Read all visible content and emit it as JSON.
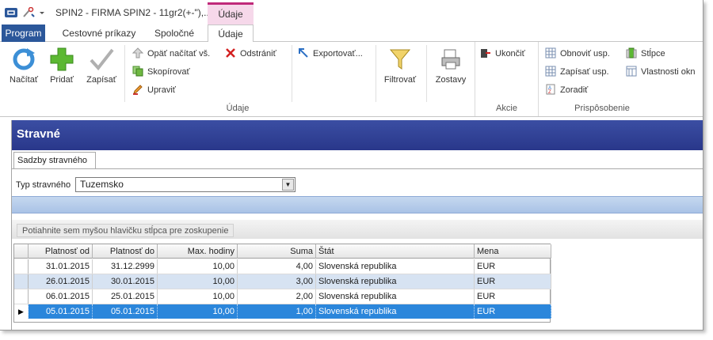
{
  "titlebar": {
    "title": "SPIN2 - FIRMA SPIN2 - 11gr2(+-\"),..",
    "context_tab": "Údaje"
  },
  "tabs": [
    {
      "label": "Program"
    },
    {
      "label": "Cestovné príkazy"
    },
    {
      "label": "Spoločné"
    },
    {
      "label": "Údaje"
    }
  ],
  "ribbon": {
    "buttons": {
      "nacitat": "Načítať",
      "pridat": "Pridať",
      "zapisat": "Zapísať",
      "opat": "Opäť načítať vš.",
      "skopirovat": "Skopírovať",
      "upravit": "Upraviť",
      "odstranit": "Odstrániť",
      "exportovat": "Exportovať...",
      "filtrovat": "Filtrovať",
      "zostavy": "Zostavy",
      "ukoncit": "Ukončiť",
      "obnovit": "Obnoviť usp.",
      "zapisat_usp": "Zapísať usp.",
      "zoradit": "Zoradiť",
      "stlpce": "Stĺpce",
      "vlastnosti": "Vlastnosti okn"
    },
    "groups": {
      "udaje": "Údaje",
      "akcie": "Akcie",
      "prisposobenie": "Prispôsobenie"
    }
  },
  "content": {
    "header": "Stravné",
    "subtab": "Sadzby stravného",
    "typ_label": "Typ stravného",
    "typ_value": "Tuzemsko",
    "group_hint": "Potiahnite sem myšou hlavičku stĺpca pre zoskupenie"
  },
  "grid": {
    "columns": [
      "Platnosť od",
      "Platnosť do",
      "Max. hodiny",
      "Suma",
      "Štát",
      "Mena"
    ],
    "rows": [
      {
        "od": "31.01.2015",
        "do": "31.12.2999",
        "hodiny": "10,00",
        "suma": "4,00",
        "stat": "Slovenská republika",
        "mena": "EUR"
      },
      {
        "od": "26.01.2015",
        "do": "30.01.2015",
        "hodiny": "10,00",
        "suma": "3,00",
        "stat": "Slovenská republika",
        "mena": "EUR"
      },
      {
        "od": "06.01.2015",
        "do": "25.01.2015",
        "hodiny": "10,00",
        "suma": "2,00",
        "stat": "Slovenská republika",
        "mena": "EUR"
      },
      {
        "od": "05.01.2015",
        "do": "05.01.2015",
        "hodiny": "10,00",
        "suma": "1,00",
        "stat": "Slovenská republika",
        "mena": "EUR"
      }
    ],
    "selected_row_marker": "▶"
  },
  "colors": {
    "accent": "#2b579a",
    "header_band": "#29378a",
    "context_tab": "#c0297a",
    "selection": "#2b86db"
  }
}
